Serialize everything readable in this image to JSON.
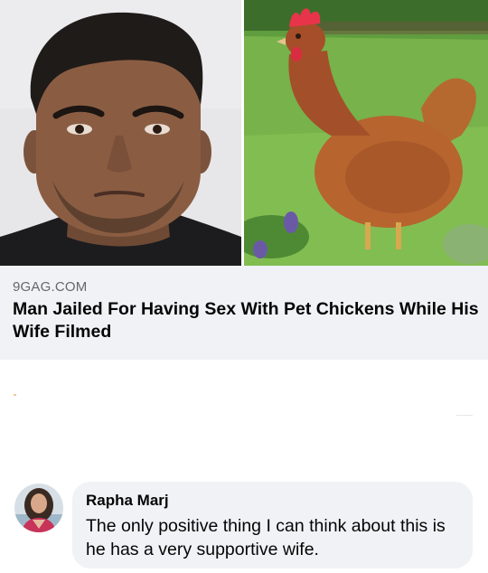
{
  "link_preview": {
    "domain": "9GAG.COM",
    "title": "Man Jailed For Having Sex With Pet Chickens While His Wife Filmed",
    "left_photo": "mugshot-photo",
    "right_photo": "chicken-photo",
    "info_icon": "info-icon"
  },
  "comment": {
    "author": "Rapha Marj",
    "text": "The only positive thing I can think about this is he has a very supportive wife.",
    "avatar": "avatar-photo"
  },
  "colors": {
    "card_background": "#f0f2f5",
    "text_primary": "#050505",
    "text_secondary": "#65676b"
  }
}
